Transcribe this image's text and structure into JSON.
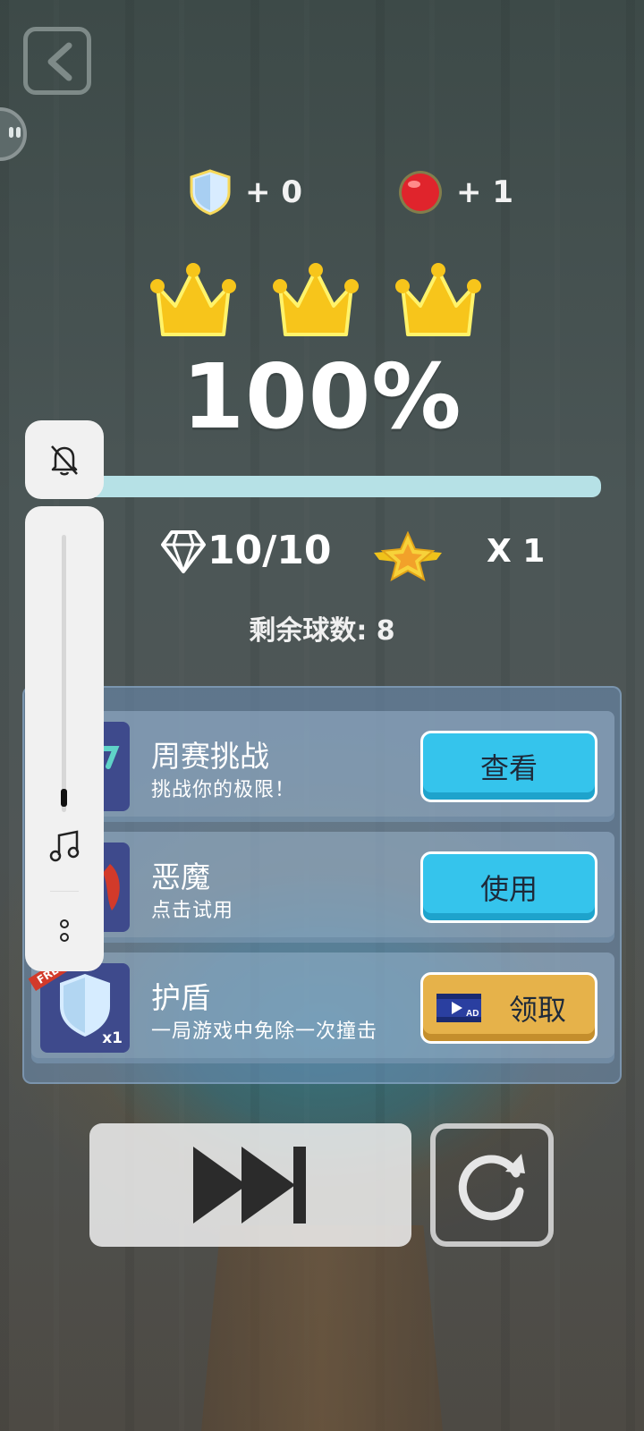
{
  "rewards": {
    "shield": "+ 0",
    "ball": "+ 1"
  },
  "result": {
    "percent": "100%",
    "progress": 1.0,
    "crowns": 3
  },
  "stats": {
    "gems": "10/10",
    "multiplier": "X 1",
    "remaining": "剩余球数: 8"
  },
  "items": [
    {
      "title": "周赛挑战",
      "subtitle": "挑战你的极限！",
      "button": "查看"
    },
    {
      "title": "恶魔",
      "subtitle": "点击试用",
      "button": "使用"
    },
    {
      "title": "护盾",
      "subtitle": "一局游戏中免除一次撞击",
      "button": "领取",
      "badge": "x1",
      "tag": "FREE",
      "ad_label": "AD"
    }
  ],
  "colors": {
    "blue_button": "#35c4ec",
    "gold_button": "#e6b24a",
    "crown": "#f7c51b",
    "progress_fill": "#b6e1e6"
  },
  "icons": [
    "back-icon",
    "shield-icon",
    "red-ball-icon",
    "crown-icon",
    "diamond-icon",
    "star-wing-icon",
    "bell-off-icon",
    "music-note-icon",
    "more-icon",
    "video-ad-icon",
    "skip-icon",
    "replay-icon"
  ]
}
